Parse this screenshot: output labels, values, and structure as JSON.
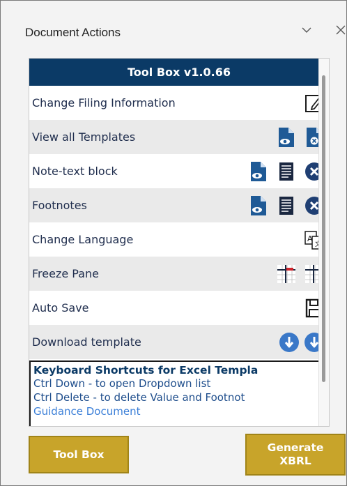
{
  "pane": {
    "title": "Document Actions",
    "chevron_icon": "chevron-down-icon",
    "close_icon": "close-icon"
  },
  "toolbox": {
    "header": "Tool Box v1.0.66",
    "rows": [
      {
        "label": "Change Filing Information",
        "icons": [
          "edit-icon"
        ]
      },
      {
        "label": "View all Templates",
        "icons": [
          "view-document-icon",
          "delete-document-icon"
        ]
      },
      {
        "label": "Note-text block",
        "icons": [
          "view-document-icon",
          "text-block-icon",
          "close-circle-icon"
        ]
      },
      {
        "label": "Footnotes",
        "icons": [
          "view-document-icon",
          "text-block-icon",
          "close-circle-icon"
        ]
      },
      {
        "label": "Change Language",
        "icons": [
          "translate-icon"
        ]
      },
      {
        "label": "Freeze Pane",
        "icons": [
          "freeze-pane-icon",
          "unfreeze-pane-icon"
        ]
      },
      {
        "label": "Auto Save",
        "icons": [
          "save-icon"
        ]
      },
      {
        "label": "Download template",
        "icons": [
          "download-icon",
          "download-icon"
        ]
      }
    ]
  },
  "shortcuts": {
    "title": "Keyboard Shortcuts for Excel Templa",
    "lines": [
      "Ctrl Down - to open Dropdown list",
      "Ctrl Delete - to delete Value and Footnot"
    ],
    "link": "Guidance Document"
  },
  "buttons": {
    "toolbox": "Tool Box",
    "generate_line1": "Generate",
    "generate_line2": "XBRL"
  },
  "colors": {
    "header_bg": "#0b3a66",
    "gold": "#c8a42a",
    "icon_blue": "#1f5a96",
    "download_blue": "#3a78c8"
  }
}
